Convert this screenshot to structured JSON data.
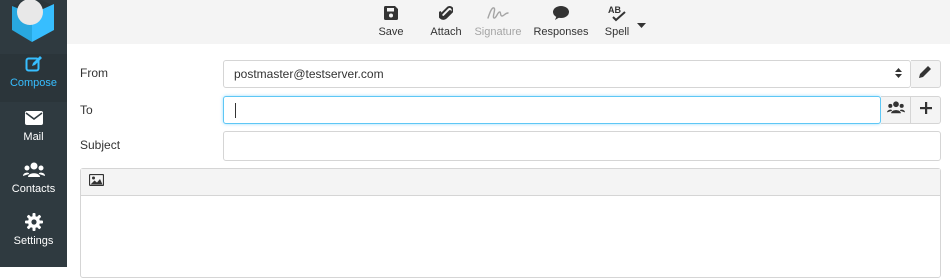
{
  "sidebar": {
    "items": [
      {
        "label": "Compose",
        "icon": "compose-icon"
      },
      {
        "label": "Mail",
        "icon": "envelope-icon"
      },
      {
        "label": "Contacts",
        "icon": "contacts-icon"
      },
      {
        "label": "Settings",
        "icon": "gear-icon"
      }
    ],
    "active": "Compose"
  },
  "toolbar": {
    "save_label": "Save",
    "attach_label": "Attach",
    "signature_label": "Signature",
    "responses_label": "Responses",
    "spell_label": "Spell",
    "spell_icon_text": "AB"
  },
  "form": {
    "from_label": "From",
    "from_value": "postmaster@testserver.com",
    "to_label": "To",
    "to_value": "",
    "subject_label": "Subject",
    "subject_value": ""
  },
  "colors": {
    "sidebar_bg": "#2f3a40",
    "accent": "#37beff",
    "toolbar_bg": "#f4f4f4",
    "border": "#d5d5d5"
  }
}
